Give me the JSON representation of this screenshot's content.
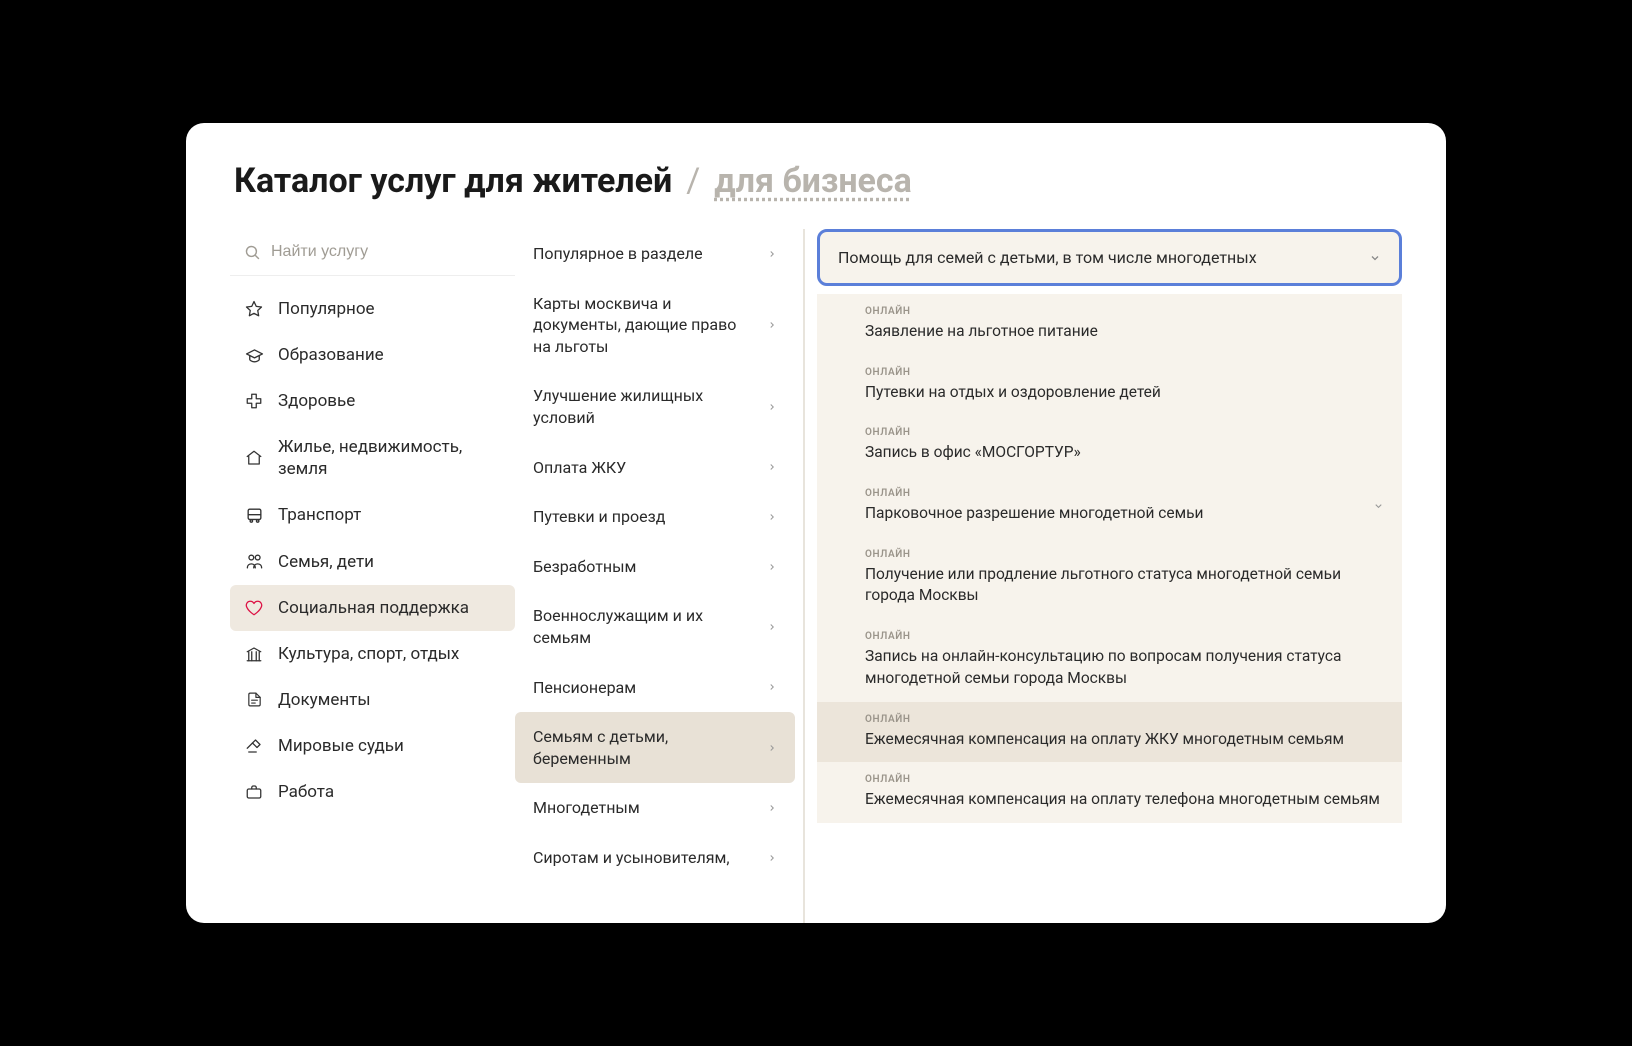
{
  "header": {
    "title_main": "Каталог услуг для жителей",
    "title_sep": "/",
    "title_alt": "для бизнеса"
  },
  "search": {
    "placeholder": "Найти услугу"
  },
  "categories": [
    {
      "icon": "star",
      "label": "Популярное"
    },
    {
      "icon": "grad",
      "label": "Образование"
    },
    {
      "icon": "health",
      "label": "Здоровье"
    },
    {
      "icon": "home",
      "label": "Жилье, недвижимость, земля"
    },
    {
      "icon": "bus",
      "label": "Транспорт"
    },
    {
      "icon": "family",
      "label": "Семья, дети"
    },
    {
      "icon": "heart",
      "label": "Социальная поддержка",
      "active": true
    },
    {
      "icon": "culture",
      "label": "Культура, спорт, отдых"
    },
    {
      "icon": "doc",
      "label": "Документы"
    },
    {
      "icon": "gavel",
      "label": "Мировые судьи"
    },
    {
      "icon": "work",
      "label": "Работа"
    }
  ],
  "subcategories": [
    {
      "label": "Популярное в разделе"
    },
    {
      "label": "Карты москвича и документы, дающие право на льготы"
    },
    {
      "label": "Улучшение жилищных условий"
    },
    {
      "label": "Оплата ЖКУ"
    },
    {
      "label": "Путевки и проезд"
    },
    {
      "label": "Безработным"
    },
    {
      "label": "Военнослужащим и их семьям"
    },
    {
      "label": "Пенсионерам"
    },
    {
      "label": "Семьям с детьми, беременным",
      "active": true
    },
    {
      "label": "Многодетным"
    },
    {
      "label": "Сиротам и усыновителям,"
    }
  ],
  "dropdown": {
    "selected": "Помощь для семей с детьми, в том числе многодетных"
  },
  "services": [
    {
      "badge": "ОНЛАЙН",
      "title": "Заявление на льготное питание"
    },
    {
      "badge": "ОНЛАЙН",
      "title": "Путевки на отдых и оздоровление детей"
    },
    {
      "badge": "ОНЛАЙН",
      "title": "Запись в офис «МОСГОРТУР»"
    },
    {
      "badge": "ОНЛАЙН",
      "title": "Парковочное разрешение многодетной семьи",
      "expandable": true
    },
    {
      "badge": "ОНЛАЙН",
      "title": "Получение или продление льготного статуса многодетной семьи города Москвы"
    },
    {
      "badge": "ОНЛАЙН",
      "title": "Запись на онлайн-консультацию по вопросам получения статуса многодетной семьи города Москвы"
    },
    {
      "badge": "ОНЛАЙН",
      "title": "Ежемесячная компенсация на оплату ЖКУ многодетным семьям",
      "hover": true
    },
    {
      "badge": "ОНЛАЙН",
      "title": "Ежемесячная компенсация на оплату телефона многодетным семьям"
    }
  ]
}
